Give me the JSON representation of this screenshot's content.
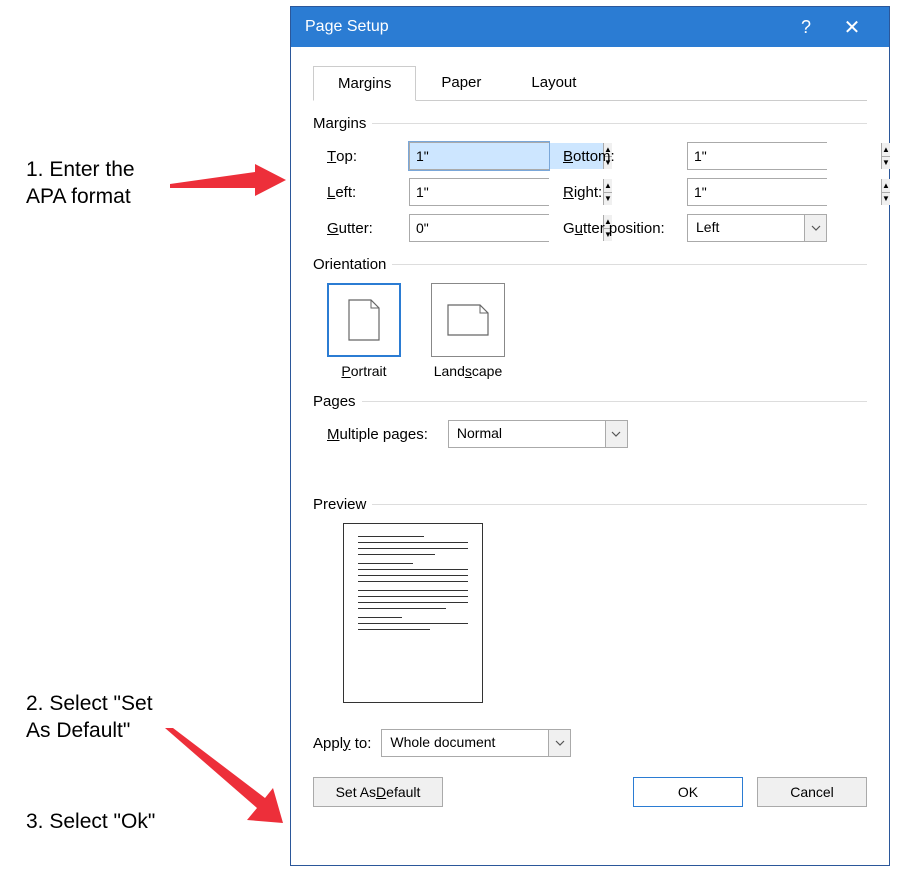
{
  "annotations": {
    "step1_line1": "1. Enter the",
    "step1_line2": "APA format",
    "step2_line1": "2. Select \"Set",
    "step2_line2": "As Default\"",
    "step3": "3. Select \"Ok\""
  },
  "dialog": {
    "title": "Page Setup"
  },
  "tabs": {
    "margins": "Margins",
    "paper": "Paper",
    "layout": "Layout"
  },
  "sections": {
    "margins": "Margins",
    "orientation": "Orientation",
    "pages": "Pages",
    "preview": "Preview"
  },
  "labels": {
    "top": "Top:",
    "top_u": "T",
    "bottom": "Bottom:",
    "bottom_u": "B",
    "left": "Left:",
    "left_u": "L",
    "right": "Right:",
    "right_u": "R",
    "gutter": "Gutter:",
    "gutter_u": "G",
    "gutterpos": "Gutter position:",
    "gutterpos_u": "u",
    "multiple": "Multiple pages:",
    "multiple_u": "M",
    "applyto": "Apply to:",
    "applyto_u": "y"
  },
  "values": {
    "top": "1\"",
    "bottom": "1\"",
    "left": "1\"",
    "right": "1\"",
    "gutter": "0\"",
    "gutterpos": "Left",
    "multiple": "Normal",
    "applyto": "Whole document"
  },
  "orientation": {
    "portrait": "Portrait",
    "portrait_u": "P",
    "landscape": "Landscape",
    "landscape_u": "s"
  },
  "buttons": {
    "setdefault": "Set As Default",
    "setdefault_u": "D",
    "ok": "OK",
    "cancel": "Cancel"
  }
}
